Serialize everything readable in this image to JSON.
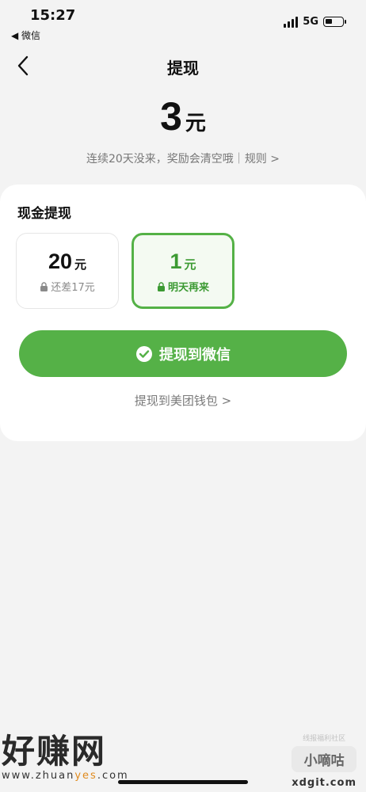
{
  "status_bar": {
    "time": "15:27",
    "back_app": "◀ 微信",
    "network": "5G"
  },
  "nav": {
    "title": "提现",
    "back_icon": "chevron-left-icon"
  },
  "balance": {
    "amount": "3",
    "unit": "元",
    "notice": "连续20天没来，奖励会清空哦｜",
    "rules_link": "规则 >"
  },
  "cash_withdraw": {
    "section_title": "现金提现",
    "options": [
      {
        "amount": "20",
        "unit": "元",
        "status": "还差17元",
        "selected": false
      },
      {
        "amount": "1",
        "unit": "元",
        "status": "明天再来",
        "selected": true
      }
    ],
    "primary_button": "提现到微信",
    "secondary_link": "提现到美团钱包 >"
  },
  "watermarks": {
    "left_brand": "好赚网",
    "left_url_prefix": "www.zhuan",
    "left_url_highlight": "yes",
    "left_url_suffix": ".com",
    "right_small": "线报福利社区",
    "right_box": "小嘀咕",
    "right_domain": "xdgit.com"
  },
  "colors": {
    "accent_green": "#55b147",
    "background": "#f3f3f3"
  }
}
